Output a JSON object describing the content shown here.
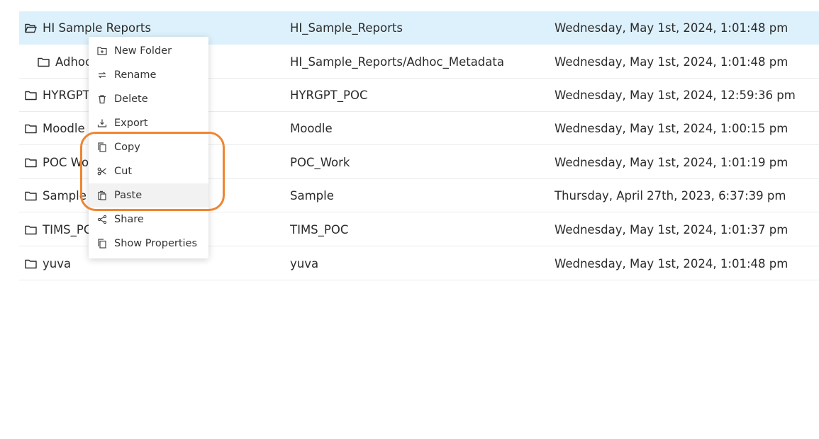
{
  "header_row": {
    "name": "",
    "path": "",
    "date": ""
  },
  "rows": [
    {
      "name": "HI Sample Reports",
      "path": "HI_Sample_Reports",
      "date": "Wednesday, May 1st, 2024, 1:01:48 pm"
    },
    {
      "name": "Adhoc",
      "path": "HI_Sample_Reports/Adhoc_Metadata",
      "date": "Wednesday, May 1st, 2024, 1:01:48 pm"
    },
    {
      "name": "HYRGPT",
      "path": "HYRGPT_POC",
      "date": "Wednesday, May 1st, 2024, 12:59:36 pm"
    },
    {
      "name": "Moodle",
      "path": "Moodle",
      "date": "Wednesday, May 1st, 2024, 1:00:15 pm"
    },
    {
      "name": "POC Wo",
      "path": "POC_Work",
      "date": "Wednesday, May 1st, 2024, 1:01:19 pm"
    },
    {
      "name": "Sample",
      "path": "Sample",
      "date": "Thursday, April 27th, 2023, 6:37:39 pm"
    },
    {
      "name": "TIMS_PC",
      "path": "TIMS_POC",
      "date": "Wednesday, May 1st, 2024, 1:01:37 pm"
    },
    {
      "name": "yuva",
      "path": "yuva",
      "date": "Wednesday, May 1st, 2024, 1:01:48 pm"
    }
  ],
  "context_menu": {
    "items": [
      {
        "label": "New Folder",
        "icon": "new-folder-icon"
      },
      {
        "label": "Rename",
        "icon": "rename-icon"
      },
      {
        "label": "Delete",
        "icon": "trash-icon"
      },
      {
        "label": "Export",
        "icon": "export-icon"
      },
      {
        "label": "Copy",
        "icon": "copy-icon"
      },
      {
        "label": "Cut",
        "icon": "scissors-icon"
      },
      {
        "label": "Paste",
        "icon": "paste-icon"
      },
      {
        "label": "Share",
        "icon": "share-icon"
      },
      {
        "label": "Show Properties",
        "icon": "properties-icon"
      }
    ]
  },
  "colors": {
    "selected_row": "#ddf1fc",
    "annotation": "#f08530"
  }
}
